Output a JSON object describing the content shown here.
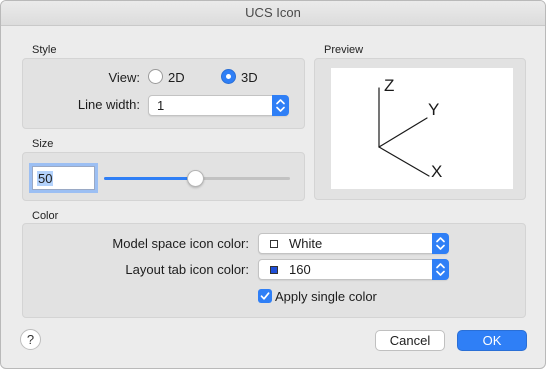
{
  "window": {
    "title": "UCS Icon"
  },
  "style": {
    "section_label": "Style",
    "view_label": "View:",
    "view_options": [
      "2D",
      "3D"
    ],
    "view_selected": "3D",
    "line_width_label": "Line width:",
    "line_width_value": "1"
  },
  "size": {
    "section_label": "Size",
    "value": "50",
    "slider_fraction": 0.49
  },
  "preview": {
    "section_label": "Preview",
    "axis_x": "X",
    "axis_y": "Y",
    "axis_z": "Z"
  },
  "color": {
    "section_label": "Color",
    "model_label": "Model space icon color:",
    "model_value": "White",
    "model_swatch": "#ffffff",
    "layout_label": "Layout tab icon color:",
    "layout_value": "160",
    "layout_swatch": "#1f4fd8",
    "apply_single_label": "Apply single color",
    "apply_single_checked": true
  },
  "buttons": {
    "help": "?",
    "cancel": "Cancel",
    "ok": "OK"
  },
  "colors": {
    "accent": "#2f7ff6"
  }
}
